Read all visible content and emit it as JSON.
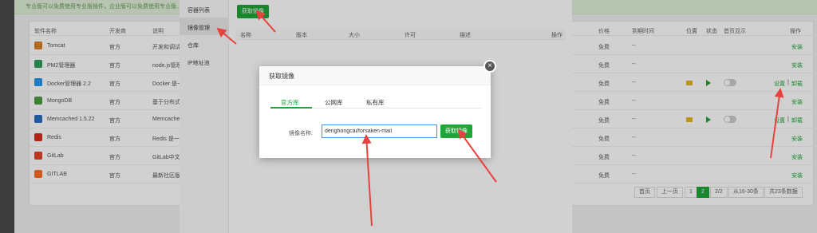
{
  "banner": {
    "text": "专业版可以免费使用专业版插件，企业版可以免费使用专业版..."
  },
  "table": {
    "headers": {
      "name": "软件名称",
      "dev": "开发商",
      "desc": "说明",
      "price": "价格",
      "expire": "到期时间",
      "pos": "位置",
      "status": "状态",
      "home": "首页显示",
      "ops": "操作"
    },
    "rows": [
      {
        "name": "Tomcat",
        "dev": "官方",
        "desc": "开发和调试",
        "price": "免费",
        "expire": "--",
        "op": "安装",
        "icon_color": "#d9822b"
      },
      {
        "name": "PM2管理器",
        "dev": "官方",
        "desc": "node.js管理",
        "price": "免费",
        "expire": "--",
        "op": "安装",
        "icon_color": "#2f9e5a"
      },
      {
        "name": "Docker管理器 2.2",
        "dev": "官方",
        "desc": "Docker 是一",
        "price": "免费",
        "expire": "--",
        "op_set": "设置",
        "op_sep": "|",
        "op_uninstall": "卸载",
        "icon_color": "#2496ed"
      },
      {
        "name": "MongoDB",
        "dev": "官方",
        "desc": "基于分布式",
        "price": "免费",
        "expire": "--",
        "op": "安装",
        "icon_color": "#4a9e3f"
      },
      {
        "name": "Memcached 1.5.22",
        "dev": "官方",
        "desc": "Memcache",
        "price": "免费",
        "expire": "--",
        "op_set": "设置",
        "op_sep": "|",
        "op_uninstall": "卸载",
        "icon_color": "#2a6ebb"
      },
      {
        "name": "Redis",
        "dev": "官方",
        "desc": "Redis 是一",
        "price": "免费",
        "expire": "--",
        "op": "安装",
        "icon_color": "#d82c20"
      },
      {
        "name": "GitLab",
        "dev": "官方",
        "desc": "GitLab中文",
        "price": "免费",
        "expire": "--",
        "op": "安装",
        "icon_color": "#e24329"
      },
      {
        "name": "GITLAB",
        "dev": "官方",
        "desc": "最新社区版",
        "price": "免费",
        "expire": "--",
        "op": "安装",
        "icon_color": "#fc6d26"
      }
    ]
  },
  "pagination": {
    "first": "首页",
    "prev": "上一页",
    "p1": "1",
    "p2": "2",
    "info": "2/2",
    "range": "从16-30条",
    "total": "共23条数据"
  },
  "panel": {
    "sidebar": [
      "容器列表",
      "镜像管理",
      "仓库",
      "IP地址池"
    ],
    "get_image_button": "获取镜像",
    "columns": {
      "name": "名称",
      "version": "版本",
      "size": "大小",
      "license": "许可",
      "desc": "描述",
      "ops": "操作"
    }
  },
  "modal": {
    "title": "获取镜像",
    "close": "×",
    "tabs": [
      "官方库",
      "公网库",
      "私有库"
    ],
    "field_label": "镜像名称:",
    "field_value": "denghongcai/forsaken-mail",
    "submit": "获取镜像"
  },
  "colors": {
    "accent": "#20a53a",
    "arrow": "#e8423f"
  }
}
